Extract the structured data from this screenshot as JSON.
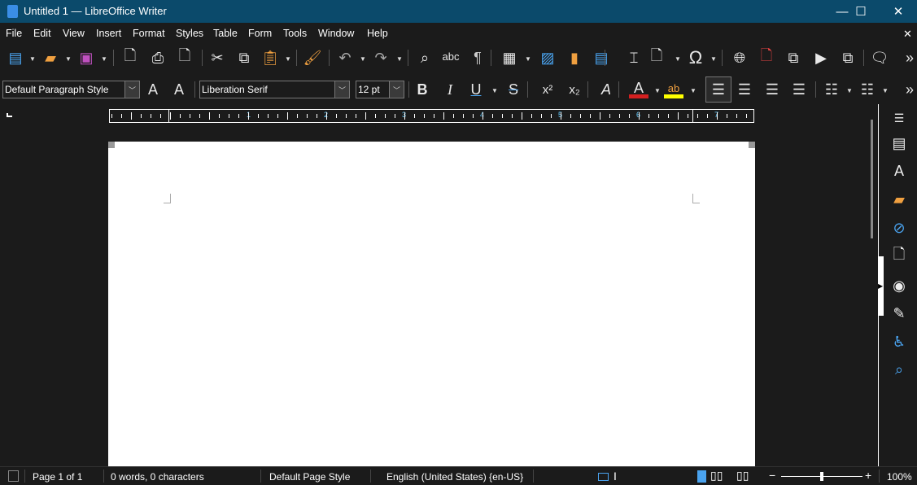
{
  "window": {
    "title": "Untitled 1 — LibreOffice Writer",
    "minimize": "—",
    "maximize": "☐",
    "close": "✕"
  },
  "menu": {
    "items": [
      "File",
      "Edit",
      "View",
      "Insert",
      "Format",
      "Styles",
      "Table",
      "Form",
      "Tools",
      "Window",
      "Help"
    ],
    "close_doc": "✕"
  },
  "toolbar_standard": {
    "more": "»",
    "icons": [
      "new-document-icon",
      "open-folder-icon",
      "save-icon",
      "export-pdf-icon",
      "print-icon",
      "print-preview-icon",
      "cut-icon",
      "copy-icon",
      "paste-icon",
      "clone-formatting-icon",
      "undo-icon",
      "redo-icon",
      "find-replace-icon",
      "spelling-icon",
      "formatting-marks-icon",
      "table-icon",
      "image-icon",
      "chart-icon",
      "text-box-icon",
      "page-break-icon",
      "field-icon",
      "special-character-icon",
      "hyperlink-icon",
      "footnote-icon",
      "cross-reference-icon",
      "bookmark-icon",
      "track-changes-icon",
      "comment-icon"
    ],
    "spelling_text": "abc",
    "omega": "Ω",
    "pilcrow": "¶"
  },
  "toolbar_formatting": {
    "paragraph_style": "Default Paragraph Style",
    "font_name": "Liberation Serif",
    "font_size": "12 pt",
    "bold": "B",
    "italic": "I",
    "underline": "U",
    "strike": "S",
    "superscript": "x²",
    "subscript": "x₂",
    "more": "»",
    "font_color": "#d42020",
    "highlight_color": "#ffff00",
    "active_alignment": "left"
  },
  "ruler": {
    "unit_labels": [
      "1",
      "2",
      "3",
      "4",
      "5",
      "6",
      "7"
    ]
  },
  "status": {
    "page": "Page 1 of 1",
    "words": "0 words, 0 characters",
    "page_style": "Default Page Style",
    "language": "English (United States) {en-US}",
    "zoom": "100%",
    "zoom_minus": "−",
    "zoom_plus": "+",
    "zoom_level": 0.5
  },
  "sidebar": {
    "icons": [
      "menu-icon",
      "properties-icon",
      "styles-icon",
      "gallery-icon",
      "navigator-icon",
      "page-icon",
      "style-inspector-icon",
      "manage-changes-icon",
      "accessibility-check-icon",
      "find-icon"
    ]
  }
}
